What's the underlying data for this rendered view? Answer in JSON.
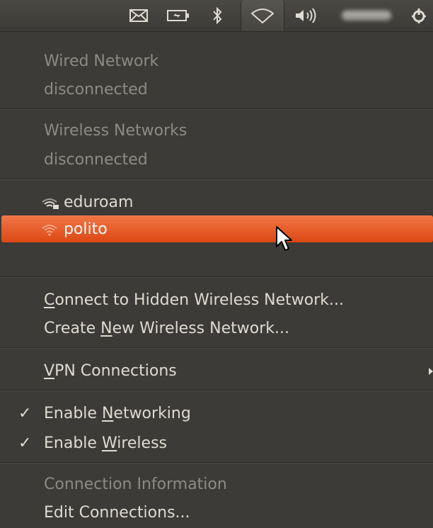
{
  "panel": {
    "icons": [
      "mail-icon",
      "battery-icon",
      "bluetooth-icon",
      "wireless-icon",
      "volume-icon",
      "user-name-blurred",
      "power-icon"
    ]
  },
  "menu": {
    "wired_title": "Wired Network",
    "wired_status": "disconnected",
    "wireless_title": "Wireless Networks",
    "wireless_status": "disconnected",
    "networks": [
      "eduroam",
      "polito"
    ],
    "hidden_pre": "",
    "hidden_u": "C",
    "hidden_post": "onnect to Hidden Wireless Network...",
    "create_pre": "Create ",
    "create_u": "N",
    "create_post": "ew Wireless Network...",
    "vpn_u": "V",
    "vpn_post": "PN Connections",
    "enable_net_pre": "Enable ",
    "enable_net_u": "N",
    "enable_net_post": "etworking",
    "enable_wl_pre": "Enable ",
    "enable_wl_u": "W",
    "enable_wl_post": "ireless",
    "conn_info": "Connection Information",
    "edit": "Edit Connections..."
  },
  "colors": {
    "highlight": "#dd4814",
    "menu_bg": "#3c3b37",
    "text": "#dfdbd2",
    "dim_text": "#8d8b84"
  }
}
